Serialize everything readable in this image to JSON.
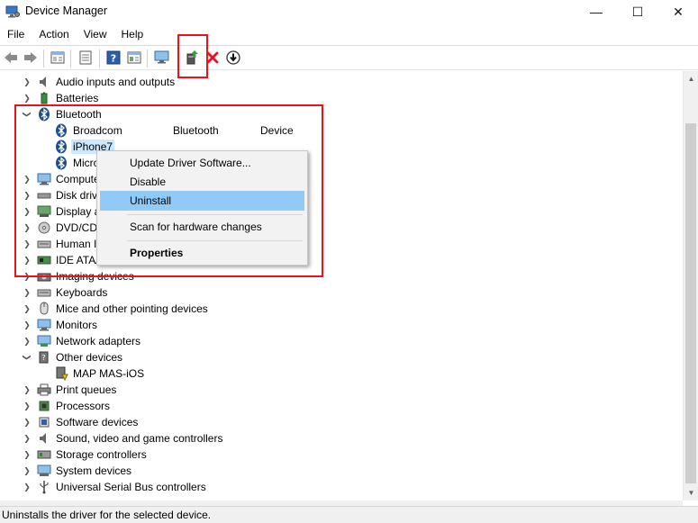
{
  "window": {
    "title": "Device Manager",
    "minimize_glyph": "—",
    "maximize_glyph": "☐",
    "close_glyph": "✕"
  },
  "menu": [
    "File",
    "Action",
    "View",
    "Help"
  ],
  "toolbar": {
    "buttons": [
      "back-icon",
      "forward-icon",
      "properties-sheet-icon",
      "update-list-icon",
      "help-icon",
      "show-hidden-icon",
      "scan-hardware-icon",
      "update-driver-icon",
      "uninstall-icon",
      "disable-icon"
    ],
    "uninstall_color": "#e81123"
  },
  "tree": {
    "items": [
      {
        "label": "Audio inputs and outputs",
        "icon": "speaker-icon",
        "expander": "collapsed"
      },
      {
        "label": "Batteries",
        "icon": "battery-icon",
        "expander": "collapsed"
      },
      {
        "label": "Bluetooth",
        "icon": "bluetooth-icon",
        "expander": "expanded"
      },
      {
        "label": "Broadcom",
        "icon": "bluetooth-icon",
        "col2": "Bluetooth",
        "col3": "Device",
        "child": true
      },
      {
        "label": "iPhone7",
        "icon": "bluetooth-icon",
        "child": true,
        "selected": true
      },
      {
        "label": "Micro",
        "icon": "bluetooth-icon",
        "child": true
      },
      {
        "label": "Compute",
        "icon": "computer-icon",
        "expander": "collapsed"
      },
      {
        "label": "Disk driv",
        "icon": "disk-drive-icon",
        "expander": "collapsed"
      },
      {
        "label": "Display a",
        "icon": "display-adapter-icon",
        "expander": "collapsed"
      },
      {
        "label": "DVD/CD-",
        "icon": "dvd-icon",
        "expander": "collapsed"
      },
      {
        "label": "Human I",
        "icon": "keyboard-icon",
        "expander": "collapsed"
      },
      {
        "label": "IDE ATA/",
        "icon": "ide-controller-icon",
        "expander": "collapsed"
      },
      {
        "label": "Imaging devices",
        "icon": "camera-icon",
        "expander": "collapsed"
      },
      {
        "label": "Keyboards",
        "icon": "keyboard-icon",
        "expander": "collapsed"
      },
      {
        "label": "Mice and other pointing devices",
        "icon": "mouse-icon",
        "expander": "collapsed"
      },
      {
        "label": "Monitors",
        "icon": "monitor-icon",
        "expander": "collapsed"
      },
      {
        "label": "Network adapters",
        "icon": "network-adapter-icon",
        "expander": "collapsed"
      },
      {
        "label": "Other devices",
        "icon": "unknown-device-icon",
        "expander": "expanded"
      },
      {
        "label": "MAP MAS-iOS",
        "icon": "warning-device-icon",
        "child": true
      },
      {
        "label": "Print queues",
        "icon": "printer-icon",
        "expander": "collapsed"
      },
      {
        "label": "Processors",
        "icon": "processor-icon",
        "expander": "collapsed"
      },
      {
        "label": "Software devices",
        "icon": "software-device-icon",
        "expander": "collapsed"
      },
      {
        "label": "Sound, video and game controllers",
        "icon": "speaker-icon",
        "expander": "collapsed"
      },
      {
        "label": "Storage controllers",
        "icon": "storage-controller-icon",
        "expander": "collapsed"
      },
      {
        "label": "System devices",
        "icon": "system-device-icon",
        "expander": "collapsed"
      },
      {
        "label": "Universal Serial Bus controllers",
        "icon": "usb-icon",
        "expander": "collapsed"
      }
    ]
  },
  "context_menu": {
    "items": [
      "Update Driver Software...",
      "Disable",
      "Uninstall",
      "Scan for hardware changes",
      "Properties"
    ],
    "highlighted": "Uninstall",
    "highlight_color": "#91c9f7"
  },
  "status": {
    "text": "Uninstalls the driver for the selected device."
  },
  "annotation_color": "#e8141c"
}
